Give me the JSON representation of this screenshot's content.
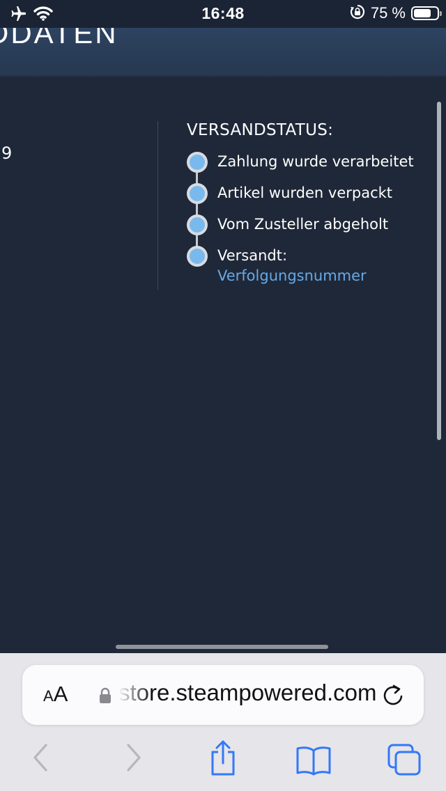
{
  "status_bar": {
    "time": "16:48",
    "battery_text": "75 %",
    "battery_level": 0.75,
    "icons": [
      "airplane-icon",
      "wifi-icon",
      "rotation-lock-icon",
      "battery-icon"
    ]
  },
  "header": {
    "title": "DDATEN"
  },
  "content": {
    "left_fragment": "9",
    "shipping": {
      "heading": "VERSANDSTATUS:",
      "steps": [
        {
          "label": "Zahlung wurde verarbeitet"
        },
        {
          "label": "Artikel wurden verpackt"
        },
        {
          "label": "Vom Zusteller abgeholt"
        },
        {
          "label": "Versandt:",
          "link": "Verfolgungsnummer"
        }
      ]
    }
  },
  "browser": {
    "aa_small": "A",
    "aa_big": "A",
    "url": "store.steampowered.com",
    "toolbar_icons": [
      "back-icon",
      "forward-icon",
      "share-icon",
      "bookmarks-icon",
      "tabs-icon"
    ]
  },
  "colors": {
    "background": "#1f2838",
    "header": "#2d4361",
    "accent_link": "#66a9e9",
    "step_dot": "#7ab9ee",
    "safari_tint": "#3478f6"
  }
}
